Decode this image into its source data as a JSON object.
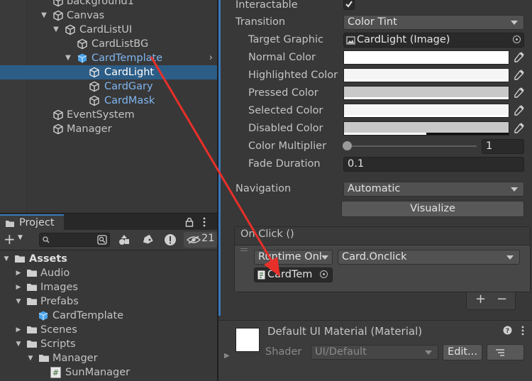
{
  "hierarchy": {
    "rows": [
      {
        "label": "background1"
      },
      {
        "label": "Canvas"
      },
      {
        "label": "CardListUI"
      },
      {
        "label": "CardListBG"
      },
      {
        "label": "CardTemplate"
      },
      {
        "label": "CardLight"
      },
      {
        "label": "CardGary"
      },
      {
        "label": "CardMask"
      },
      {
        "label": "EventSystem"
      },
      {
        "label": "Manager"
      }
    ]
  },
  "project": {
    "tab_label": "Project",
    "hidden_count": "21",
    "tree": [
      {
        "label": "Assets"
      },
      {
        "label": "Audio"
      },
      {
        "label": "Images"
      },
      {
        "label": "Prefabs"
      },
      {
        "label": "CardTemplate"
      },
      {
        "label": "Scenes"
      },
      {
        "label": "Scripts"
      },
      {
        "label": "Manager"
      },
      {
        "label": "SunManager"
      }
    ]
  },
  "inspector": {
    "interactable": {
      "label": "Interactable",
      "checked": true
    },
    "transition": {
      "label": "Transition",
      "value": "Color Tint"
    },
    "target_graphic": {
      "label": "Target Graphic",
      "value": "CardLight (Image)"
    },
    "colors": [
      {
        "label": "Normal Color",
        "color": "#ffffff"
      },
      {
        "label": "Highlighted Color",
        "color": "#f5f5f5"
      },
      {
        "label": "Pressed Color",
        "color": "#c8c8c8"
      },
      {
        "label": "Selected Color",
        "color": "#f5f5f5"
      },
      {
        "label": "Disabled Color",
        "color": "#c8c8c8"
      }
    ],
    "color_multiplier": {
      "label": "Color Multiplier",
      "value": "1"
    },
    "fade_duration": {
      "label": "Fade Duration",
      "value": "0.1"
    },
    "navigation": {
      "label": "Navigation",
      "value": "Automatic"
    },
    "visualize": "Visualize",
    "onclick": {
      "header": "On Click ()",
      "runtime": "Runtime Onl",
      "function": "Card.Onclick",
      "object": "CardTem"
    },
    "plus": "+",
    "minus": "−",
    "material": {
      "title": "Default UI Material (Material)",
      "shader_label": "Shader",
      "shader_value": "UI/Default",
      "edit": "Edit..."
    }
  },
  "colors": {
    "selection": "#2c5d87",
    "prefab_text": "#7fb5f0",
    "annotation_arrow": "#e8302a"
  }
}
